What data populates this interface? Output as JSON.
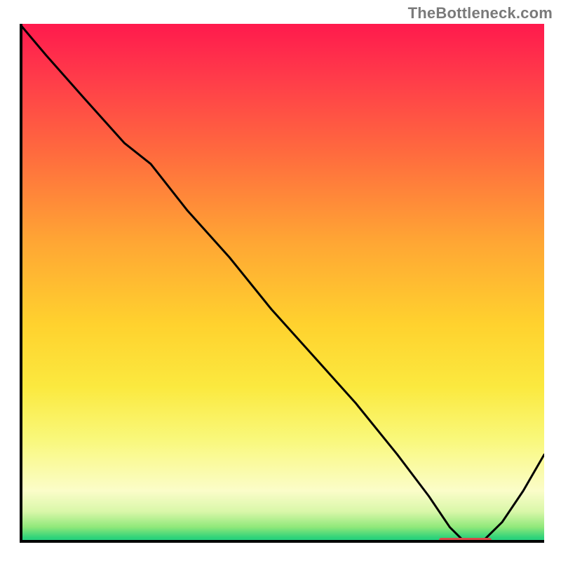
{
  "watermark": "TheBottleneck.com",
  "chart_data": {
    "type": "line",
    "title": "",
    "xlabel": "",
    "ylabel": "",
    "xlim": [
      0,
      100
    ],
    "ylim": [
      0,
      100
    ],
    "axis_ticks_visible": false,
    "grid_visible": false,
    "background": "gradient-red-to-green-vertical",
    "series": [
      {
        "name": "bottleneck-curve",
        "color": "#000000",
        "x": [
          0,
          5,
          12,
          20,
          25,
          32,
          40,
          48,
          56,
          64,
          72,
          78,
          82,
          85,
          88,
          92,
          96,
          100
        ],
        "values": [
          100,
          94,
          86,
          77,
          73,
          64,
          55,
          45,
          36,
          27,
          17,
          9,
          3,
          0,
          0,
          4,
          10,
          17
        ]
      }
    ],
    "marker_segment": {
      "color": "#d84a48",
      "x_start": 80,
      "x_end": 90,
      "y": 0.6,
      "thickness_pct": 0.8
    },
    "gradient_stops": [
      {
        "offset": 0,
        "color": "#ff1a4d"
      },
      {
        "offset": 10,
        "color": "#ff3a4a"
      },
      {
        "offset": 25,
        "color": "#ff6b3e"
      },
      {
        "offset": 42,
        "color": "#ffa634"
      },
      {
        "offset": 58,
        "color": "#ffd22e"
      },
      {
        "offset": 70,
        "color": "#fbe93f"
      },
      {
        "offset": 80,
        "color": "#f9f87a"
      },
      {
        "offset": 90,
        "color": "#fbfdc9"
      },
      {
        "offset": 94,
        "color": "#d9f7a9"
      },
      {
        "offset": 97,
        "color": "#8fe87a"
      },
      {
        "offset": 99,
        "color": "#2fd37a"
      },
      {
        "offset": 100,
        "color": "#1ecf84"
      }
    ]
  }
}
